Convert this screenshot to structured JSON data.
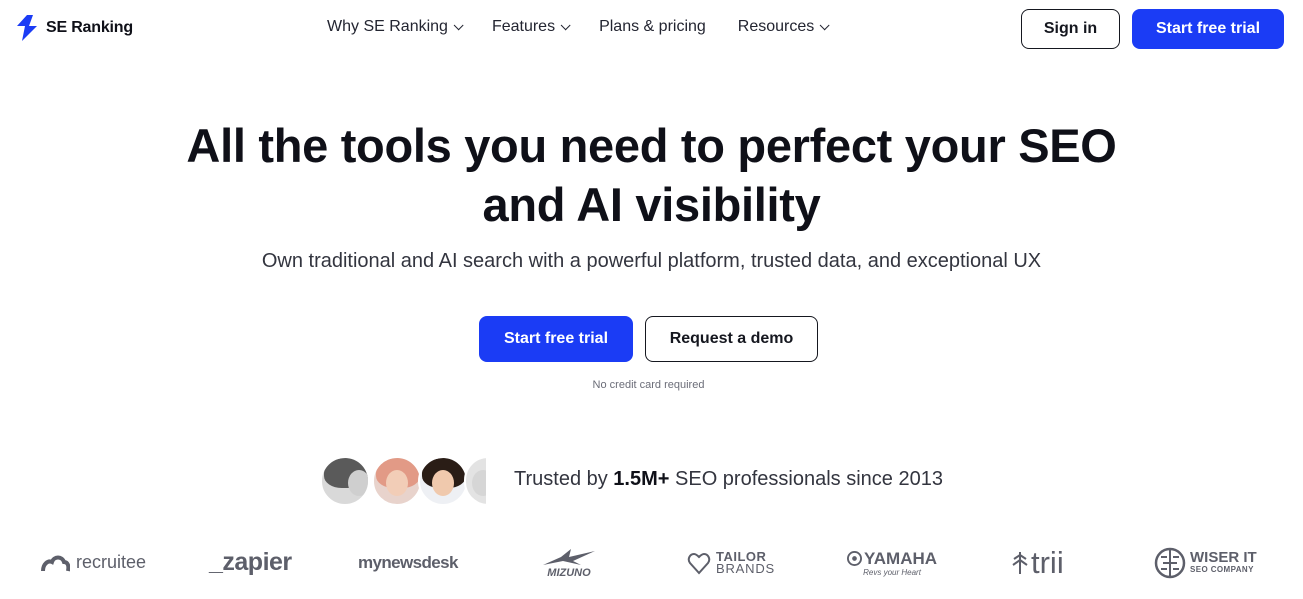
{
  "brand": {
    "name": "SE Ranking",
    "accent": "#1b3cf5"
  },
  "nav": {
    "items": [
      {
        "label": "Why SE Ranking",
        "has_dropdown": true
      },
      {
        "label": "Features",
        "has_dropdown": true
      },
      {
        "label": "Plans & pricing",
        "has_dropdown": false
      },
      {
        "label": "Resources",
        "has_dropdown": true
      }
    ],
    "sign_in": "Sign in",
    "start_trial": "Start free trial"
  },
  "hero": {
    "title_line1": "All the tools you need to perfect your SEO",
    "title_line2": "and AI visibility",
    "subtitle": "Own traditional and AI search with a powerful platform, trusted data, and exceptional UX",
    "cta_primary": "Start free trial",
    "cta_secondary": "Request a demo",
    "note": "No credit card required"
  },
  "trusted": {
    "prefix": "Trusted by ",
    "count": "1.5M+",
    "suffix": " SEO professionals since 2013"
  },
  "logos": {
    "recruitee": "recruitee",
    "zapier": "_zapier",
    "mynewsdesk": "mynewsdesk",
    "mizuno": "MIZUNO",
    "tailor_1": "TAILOR",
    "tailor_2": "BRANDS",
    "yamaha": "YAMAHA",
    "yamaha_tag": "Revs your Heart",
    "trii": "trii",
    "wiser_1": "WISER IT",
    "wiser_2": "SEO COMPANY"
  }
}
